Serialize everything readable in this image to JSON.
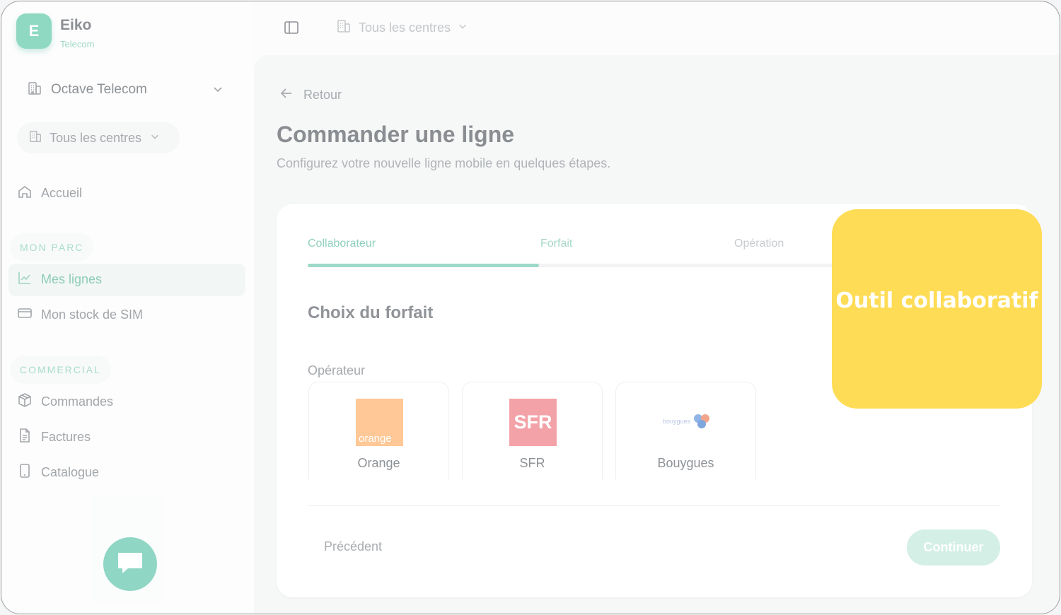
{
  "brand": {
    "initial": "E",
    "name": "Eiko",
    "subtitle": "Telecom"
  },
  "sidebar": {
    "org": "Octave Telecom",
    "centres": "Tous les centres",
    "home": "Accueil",
    "sections": [
      {
        "label": "MON PARC",
        "items": [
          "Mes lignes",
          "Mon stock de SIM"
        ]
      },
      {
        "label": "COMMERCIAL",
        "items": [
          "Commandes",
          "Factures",
          "Catalogue"
        ]
      }
    ]
  },
  "topbar": {
    "centres": "Tous les centres"
  },
  "main": {
    "back": "Retour",
    "title": "Commander une ligne",
    "subtitle": "Configurez votre nouvelle ligne mobile en quelques étapes.",
    "steps": [
      "Collaborateur",
      "Forfait",
      "Opération"
    ],
    "step_progress": 0.333,
    "section_title": "Choix du forfait",
    "operator_label": "Opérateur",
    "operators": [
      {
        "name": "Orange",
        "logo_text": "orange"
      },
      {
        "name": "SFR",
        "logo_text": "SFR"
      },
      {
        "name": "Bouygues",
        "logo_text": "bouygues"
      }
    ],
    "prev": "Précédent",
    "next": "Continuer"
  },
  "callout": {
    "text": "Outil collaboratif"
  },
  "colors": {
    "accent": "#8fd9c2",
    "callout": "#fedc55",
    "orange": "#ffc896",
    "sfr": "#f3a2a8"
  }
}
